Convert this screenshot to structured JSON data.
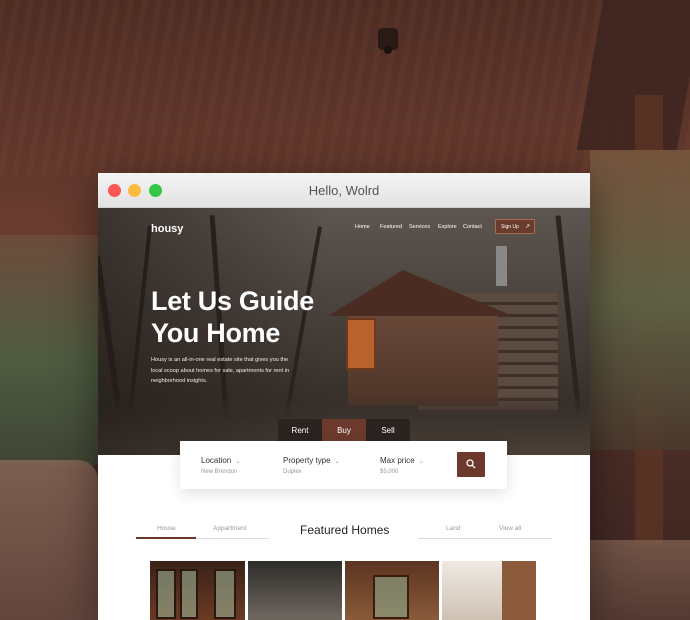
{
  "window": {
    "title": "Hello, Wolrd"
  },
  "site": {
    "logo": "housy",
    "nav": [
      "Home",
      "Featured",
      "Services",
      "Explore",
      "Contact"
    ],
    "signup": "Sign Up",
    "headline_line1": "Let Us Guide",
    "headline_line2": "You Home",
    "blurb": "Housy is an all-in-one real estate site that gives you the local scoop about homes for sale, apartments for rent in neighborhood insights."
  },
  "tabs": [
    "Rent",
    "Buy",
    "Sell"
  ],
  "active_tab": "Buy",
  "search": {
    "fields": [
      {
        "label": "Location",
        "value": "New Brendon"
      },
      {
        "label": "Property type",
        "value": "Duplex"
      },
      {
        "label": "Max price",
        "value": "$5,000"
      }
    ],
    "button_icon": "search-icon"
  },
  "featured": {
    "title": "Featured Homes",
    "tabs_left": [
      "House",
      "Appartment"
    ],
    "tabs_right": [
      "Land",
      "View all"
    ],
    "active": "House"
  },
  "colors": {
    "accent": "#6b3a2d",
    "dark": "#2b2320"
  }
}
